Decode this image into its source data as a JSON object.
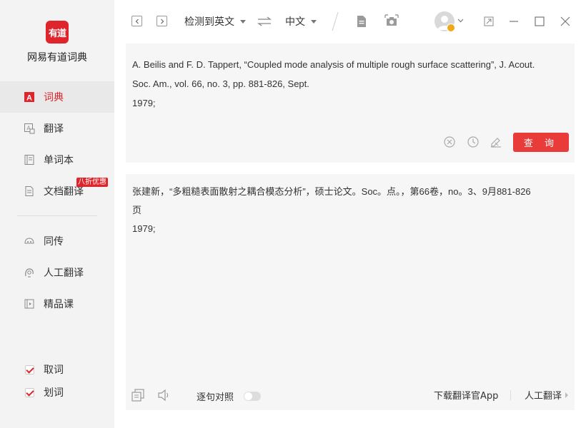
{
  "app": {
    "logo_text": "有道",
    "name": "网易有道词典"
  },
  "sidebar": {
    "items": [
      {
        "label": "词典",
        "icon": "dictionary-icon",
        "active": true
      },
      {
        "label": "翻译",
        "icon": "translate-icon"
      },
      {
        "label": "单词本",
        "icon": "wordbook-icon"
      },
      {
        "label": "文档翻译",
        "icon": "document-icon",
        "badge": "八折优惠"
      },
      {
        "label": "同传",
        "icon": "interpretation-icon"
      },
      {
        "label": "人工翻译",
        "icon": "human-translate-icon"
      },
      {
        "label": "精品课",
        "icon": "course-icon"
      }
    ],
    "checks": [
      {
        "label": "取词",
        "checked": true
      },
      {
        "label": "划词",
        "checked": true
      }
    ]
  },
  "toolbar": {
    "source_lang": "检测到英文",
    "target_lang": "中文",
    "swap_icon": "swap-icon",
    "icons": [
      "document-icon",
      "screenshot-icon",
      "avatar",
      "expand-icon",
      "minimize-icon",
      "maximize-icon",
      "close-icon"
    ]
  },
  "input": {
    "text": "A. Beilis and F. D. Tappert, “Coupled mode analysis of multiple rough surface scattering”, J. Acout.\nSoc. Am., vol. 66, no. 3, pp. 881-826, Sept.\n1979;",
    "query_label": "查 询"
  },
  "output": {
    "text": "张建新，“多粗糙表面散射之耦合模态分析”，硕士论文。Soc。点。，第66卷，no。3、9月881-826\n页\n1979;",
    "align_label": "逐句对照",
    "download_label": "下载翻译官App",
    "human_label": "人工翻译"
  },
  "colors": {
    "accent": "#e0242b",
    "sidebar_bg": "#f3f3f3",
    "panel_bg": "#f6f6f6"
  }
}
